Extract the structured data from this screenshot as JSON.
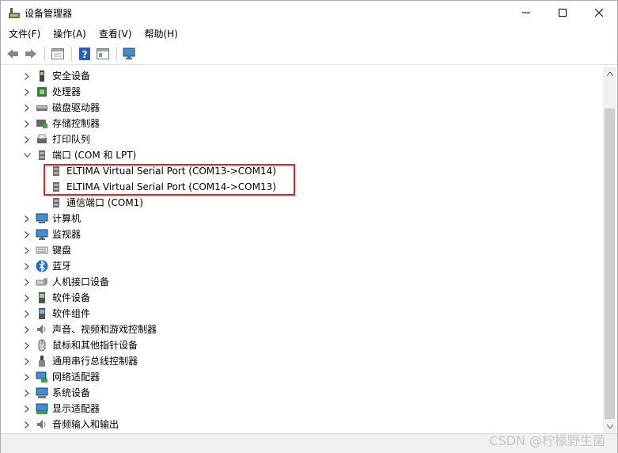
{
  "window": {
    "title": "设备管理器"
  },
  "menu": [
    {
      "label": "文件(F)"
    },
    {
      "label": "操作(A)"
    },
    {
      "label": "查看(V)"
    },
    {
      "label": "帮助(H)"
    }
  ],
  "toolbar": [
    "back-arrow-icon",
    "forward-arrow-icon",
    "properties-icon",
    "help-icon",
    "view-icon",
    "monitor-icon"
  ],
  "tree": [
    {
      "label": "安全设备",
      "icon": "security-device-icon",
      "expanded": false
    },
    {
      "label": "处理器",
      "icon": "processor-icon",
      "expanded": false
    },
    {
      "label": "磁盘驱动器",
      "icon": "disk-drive-icon",
      "expanded": false
    },
    {
      "label": "存储控制器",
      "icon": "storage-controller-icon",
      "expanded": false
    },
    {
      "label": "打印队列",
      "icon": "print-queue-icon",
      "expanded": false
    },
    {
      "label": "端口 (COM 和 LPT)",
      "icon": "port-icon",
      "expanded": true
    },
    {
      "label": "ELTIMA Virtual Serial Port (COM13->COM14)",
      "icon": "port-icon",
      "child": true
    },
    {
      "label": "ELTIMA Virtual Serial Port (COM14->COM13)",
      "icon": "port-icon",
      "child": true
    },
    {
      "label": "通信端口 (COM1)",
      "icon": "port-icon",
      "child": true
    },
    {
      "label": "计算机",
      "icon": "computer-icon",
      "expanded": false
    },
    {
      "label": "监视器",
      "icon": "monitor-icon",
      "expanded": false
    },
    {
      "label": "键盘",
      "icon": "keyboard-icon",
      "expanded": false
    },
    {
      "label": "蓝牙",
      "icon": "bluetooth-icon",
      "expanded": false
    },
    {
      "label": "人机接口设备",
      "icon": "hid-icon",
      "expanded": false
    },
    {
      "label": "软件设备",
      "icon": "software-device-icon",
      "expanded": false
    },
    {
      "label": "软件组件",
      "icon": "software-component-icon",
      "expanded": false
    },
    {
      "label": "声音、视频和游戏控制器",
      "icon": "sound-icon",
      "expanded": false
    },
    {
      "label": "鼠标和其他指针设备",
      "icon": "mouse-icon",
      "expanded": false
    },
    {
      "label": "通用串行总线控制器",
      "icon": "usb-icon",
      "expanded": false
    },
    {
      "label": "网络适配器",
      "icon": "network-adapter-icon",
      "expanded": false
    },
    {
      "label": "系统设备",
      "icon": "system-device-icon",
      "expanded": false
    },
    {
      "label": "显示适配器",
      "icon": "display-adapter-icon",
      "expanded": false
    },
    {
      "label": "音频输入和输出",
      "icon": "audio-io-icon",
      "expanded": false
    }
  ],
  "watermark": "CSDN @柠檬野生菌",
  "colors": {
    "highlight": "#d9262b"
  }
}
